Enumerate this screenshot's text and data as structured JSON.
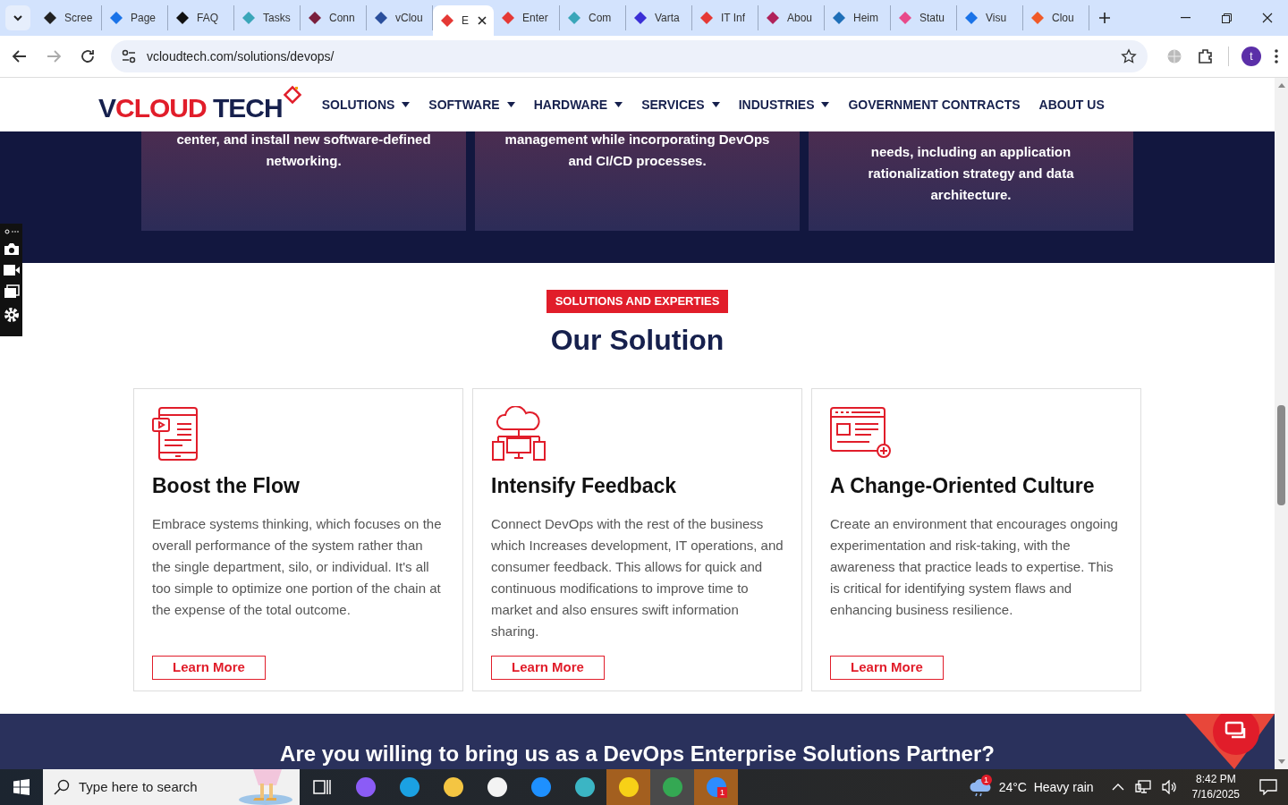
{
  "tabs": [
    {
      "title": "Scree",
      "selected": false,
      "color": "#222222"
    },
    {
      "title": "Page",
      "selected": false,
      "color": "#1a73e8"
    },
    {
      "title": "FAQ",
      "selected": false,
      "color": "#111111"
    },
    {
      "title": "Tasks",
      "selected": false,
      "color": "#3aa6b9"
    },
    {
      "title": "Conn",
      "selected": false,
      "color": "#7a1f3d"
    },
    {
      "title": "vClou",
      "selected": false,
      "color": "#2a4f9c"
    },
    {
      "title": "E",
      "selected": true,
      "color": "#e53935"
    },
    {
      "title": "Enter",
      "selected": false,
      "color": "#e53935"
    },
    {
      "title": "Com",
      "selected": false,
      "color": "#3aa6b9"
    },
    {
      "title": "Varta",
      "selected": false,
      "color": "#3b2fd6"
    },
    {
      "title": "IT Inf",
      "selected": false,
      "color": "#e53935"
    },
    {
      "title": "Abou",
      "selected": false,
      "color": "#b0225a"
    },
    {
      "title": "Heim",
      "selected": false,
      "color": "#1e6fb8"
    },
    {
      "title": "Statu",
      "selected": false,
      "color": "#e84a8a"
    },
    {
      "title": "Visu",
      "selected": false,
      "color": "#1a73e8"
    },
    {
      "title": "Clou",
      "selected": false,
      "color": "#f05a28"
    }
  ],
  "address": "vcloudtech.com/solutions/devops/",
  "profile_initial": "t",
  "logo": {
    "part_1": "V",
    "part_2": "CLOUD",
    "part_3": " TECH"
  },
  "nav": [
    {
      "label": "SOLUTIONS",
      "dropdown": true
    },
    {
      "label": "SOFTWARE",
      "dropdown": true
    },
    {
      "label": "HARDWARE",
      "dropdown": true
    },
    {
      "label": "SERVICES",
      "dropdown": true
    },
    {
      "label": "INDUSTRIES",
      "dropdown": true
    },
    {
      "label": "GOVERNMENT CONTRACTS",
      "dropdown": false
    },
    {
      "label": "ABOUT US",
      "dropdown": false
    }
  ],
  "top_cards": [
    {
      "text": "center, and install new software-defined networking."
    },
    {
      "text": "management while incorporating DevOps and CI/CD processes."
    },
    {
      "text": "needs, including an application rationalization strategy and data architecture."
    }
  ],
  "section": {
    "badge": "SOLUTIONS AND EXPERTIES",
    "title": "Our Solution"
  },
  "solutions": [
    {
      "kind": "tablet",
      "title": "Boost the Flow",
      "text": "Embrace systems thinking, which focuses on the overall performance of the system rather than the single department, silo, or individual. It's all too simple to optimize one portion of the chain at the expense of the total outcome.",
      "button": "Learn More"
    },
    {
      "kind": "cloud",
      "title": "Intensify Feedback",
      "text": "Connect DevOps with the rest of the business which Increases development, IT operations, and consumer feedback. This allows for quick and continuous modifications to improve time to market and also ensures swift information sharing.",
      "button": "Learn More"
    },
    {
      "kind": "browser",
      "title": "A Change-Oriented Culture",
      "text": "Create an environment that encourages ongoing experimentation and risk-taking, with the awareness that practice leads to expertise. This is critical for identifying system flaws and enhancing business resilience.",
      "button": "Learn More"
    }
  ],
  "cta": {
    "title": "Are you willing to bring us as a DevOps Enterprise Solutions Partner?"
  },
  "taskbar": {
    "search_placeholder": "Type here to search",
    "weather_badge": "1",
    "weather": "24°C  Heavy rain",
    "time": "8:42 PM",
    "date": "7/16/2025",
    "zoom_badge": "1"
  }
}
